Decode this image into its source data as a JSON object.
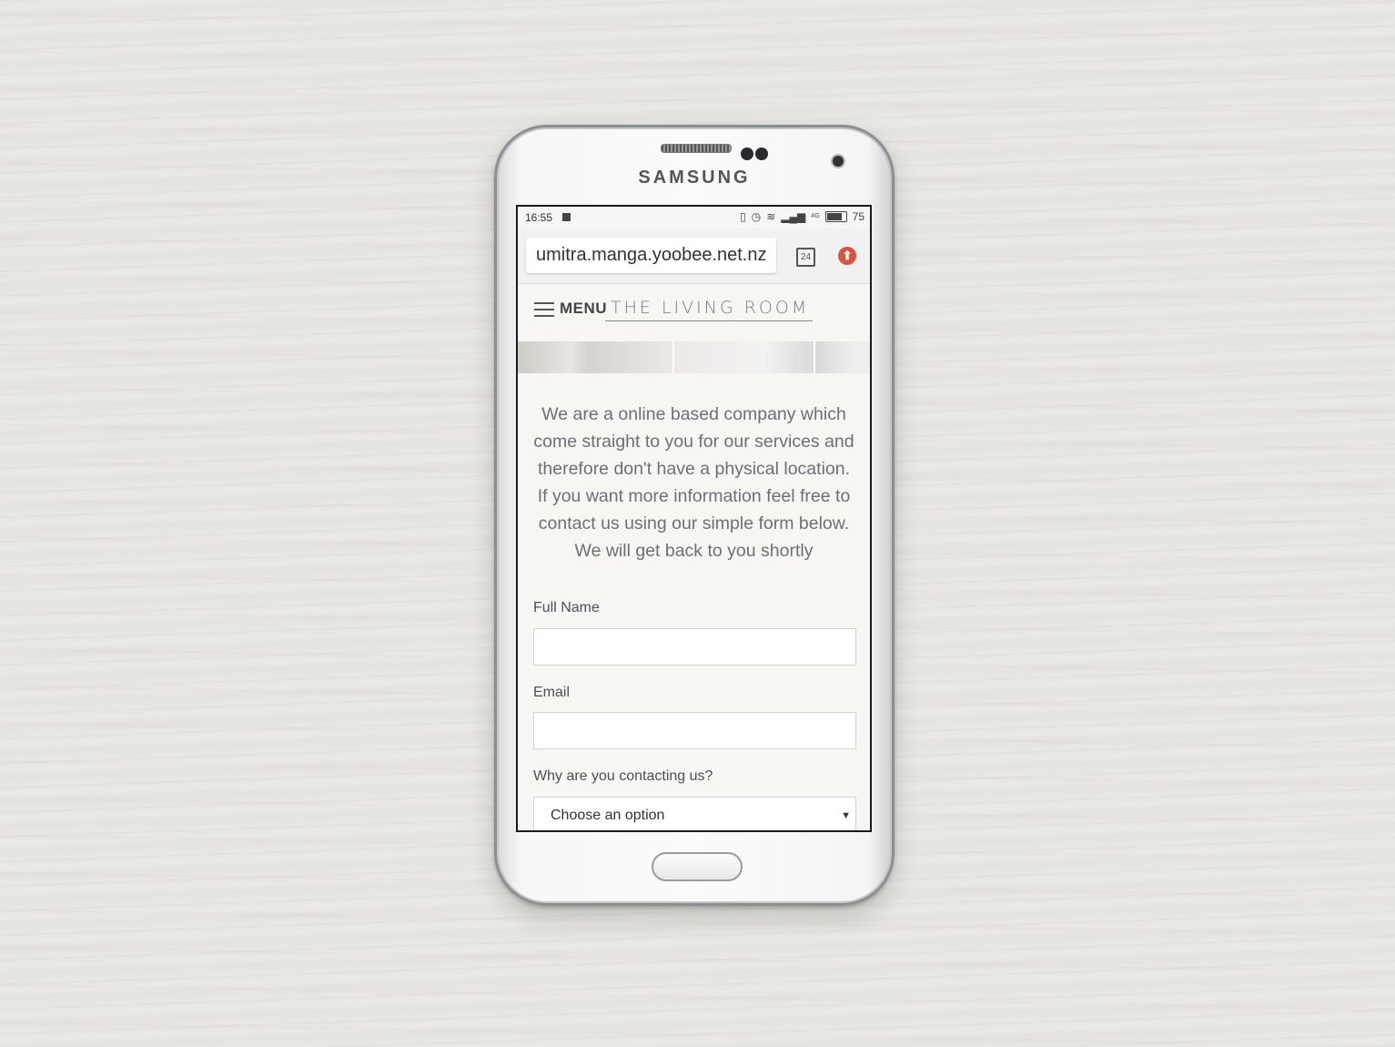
{
  "device": {
    "brand": "SAMSUNG"
  },
  "status_bar": {
    "time": "16:55",
    "network": "4G",
    "battery": "75"
  },
  "browser": {
    "url": "umitra.manga.yoobee.net.nz",
    "tab_count": "24"
  },
  "site": {
    "menu_label": "MENU",
    "logo_text": "THE LIVING ROOM",
    "intro": "We are a online based company which come straight to you for our services and therefore don't have a physical location. If you want more information feel free to contact us using our simple form below. We will get back to you shortly"
  },
  "form": {
    "full_name_label": "Full Name",
    "full_name_value": "",
    "email_label": "Email",
    "email_value": "",
    "reason_label": "Why are you contacting us?",
    "reason_selected": "Choose an option"
  },
  "icons": [
    "hamburger-icon",
    "tabs-icon",
    "update-icon",
    "vibrate-icon",
    "alarm-icon",
    "wifi-icon",
    "signal-icon",
    "battery-icon",
    "calendar-icon"
  ],
  "colors": {
    "page_background": "#f8f6f3",
    "body_text": "#6b6f78",
    "update_button": "#d9533f"
  }
}
